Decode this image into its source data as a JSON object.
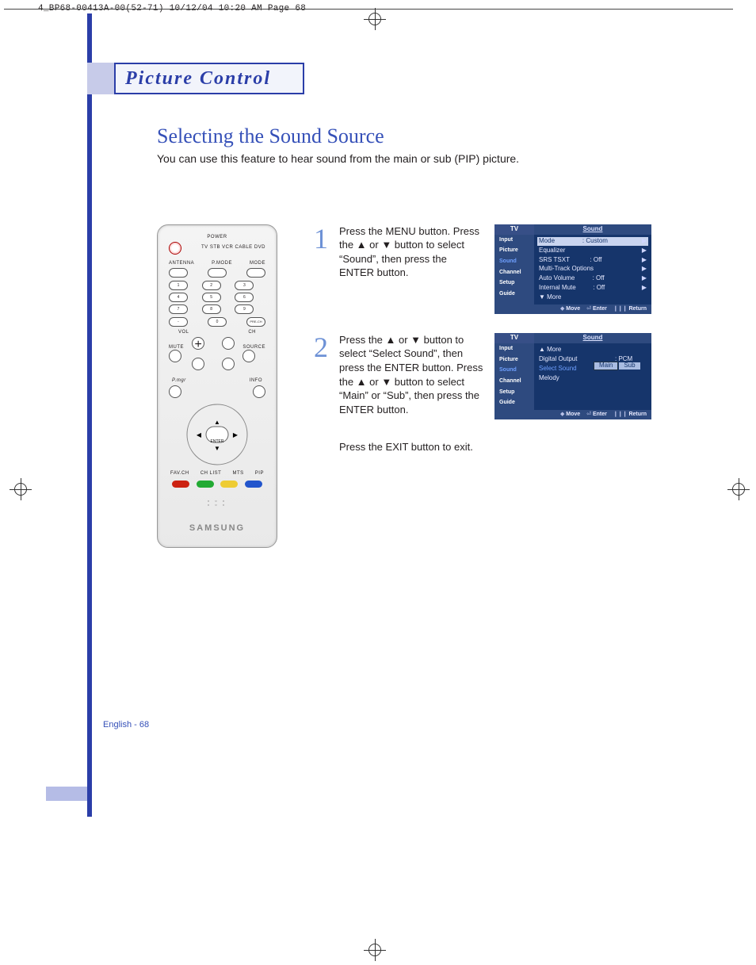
{
  "slug": "4_BP68-00413A-00(52-71)  10/12/04  10:20 AM  Page 68",
  "section": "Picture Control",
  "title": "Selecting the Sound Source",
  "lead": "You can use this feature to hear sound from the main or sub (PIP) picture.",
  "steps": [
    {
      "n": "1",
      "text": "Press the MENU button. Press the ▲ or ▼ button to select “Sound”, then press the ENTER button."
    },
    {
      "n": "2",
      "text": "Press the ▲ or ▼ button to select “Select Sound”, then press the ENTER button. Press the ▲ or ▼ button to select “Main” or “Sub”, then press the ENTER button."
    }
  ],
  "step2_exit": "Press the EXIT button to exit.",
  "remote": {
    "power": "POWER",
    "antenna": "ANTENNA",
    "pmode": "P.MODE",
    "mode": "MODE",
    "devrow": "TV   STB   VCR  CABLE  DVD",
    "precch": "PRE-CH",
    "vol": "VOL",
    "ch": "CH",
    "mute": "MUTE",
    "source": "SOURCE",
    "pmgr": "P.mgr",
    "info": "INFO",
    "enter": "ENTER",
    "favch": "FAV.CH",
    "chlist": "CH LIST",
    "mts": "MTS",
    "pip": "PIP",
    "brand": "SAMSUNG",
    "digits": [
      "1",
      "2",
      "3",
      "4",
      "5",
      "6",
      "7",
      "8",
      "9",
      "-",
      "0"
    ]
  },
  "osd": {
    "tv": "TV",
    "title": "Sound",
    "menu": [
      "Input",
      "Picture",
      "Sound",
      "Channel",
      "Setup",
      "Guide"
    ],
    "footer": {
      "move": "Move",
      "enter": "Enter",
      "return": "Return"
    },
    "screen1": [
      {
        "label": "Mode",
        "val": ": Custom",
        "sel": true
      },
      {
        "label": "Equalizer",
        "val": ""
      },
      {
        "label": "SRS TSXT",
        "val": ": Off"
      },
      {
        "label": "Multi-Track Options",
        "val": ""
      },
      {
        "label": "Auto Volume",
        "val": ": Off"
      },
      {
        "label": "Internal Mute",
        "val": ": Off"
      },
      {
        "label": "▼ More",
        "val": "",
        "noarr": true
      }
    ],
    "screen2": {
      "rows": [
        {
          "label": "▲ More",
          "val": "",
          "noarr": true
        },
        {
          "label": "Digital Output",
          "val": ": PCM"
        },
        {
          "label": "Select Sound",
          "val": "",
          "on": true
        },
        {
          "label": "Melody",
          "val": ""
        }
      ],
      "options": [
        "Main",
        "Sub"
      ]
    }
  },
  "footer": "English - 68"
}
